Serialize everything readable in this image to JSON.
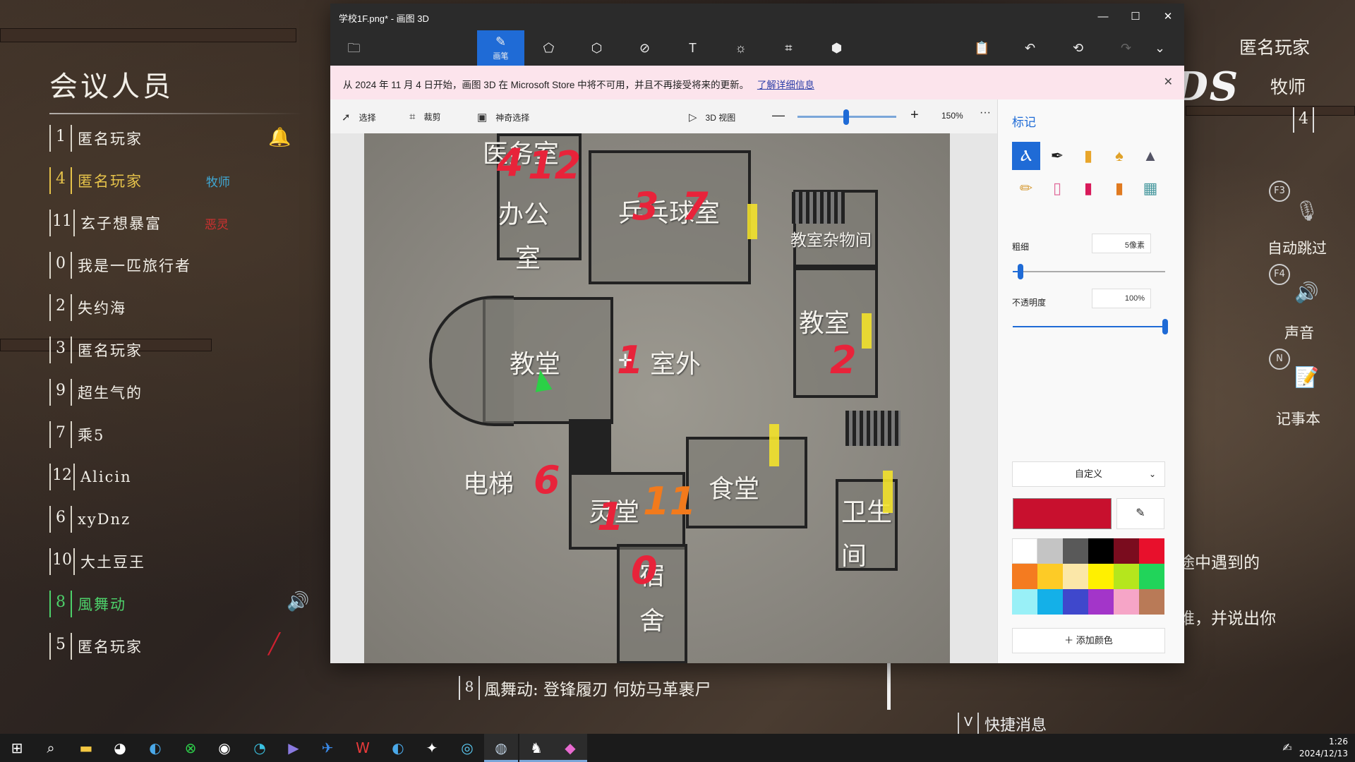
{
  "meeting": {
    "title": "会议人员",
    "members": [
      {
        "num": "1",
        "name": "匿名玩家",
        "role": "",
        "role_color": ""
      },
      {
        "num": "4",
        "name": "匿名玩家",
        "role": "牧师",
        "role_color": "#3fa9d6"
      },
      {
        "num": "11",
        "name": "玄子想暴富",
        "role": "恶灵",
        "role_color": "#d23030"
      },
      {
        "num": "0",
        "name": "我是一匹旅行者",
        "role": "",
        "role_color": ""
      },
      {
        "num": "2",
        "name": "失约海",
        "role": "",
        "role_color": ""
      },
      {
        "num": "3",
        "name": "匿名玩家",
        "role": "",
        "role_color": ""
      },
      {
        "num": "9",
        "name": "超生气的",
        "role": "",
        "role_color": ""
      },
      {
        "num": "7",
        "name": "乘5",
        "role": "",
        "role_color": ""
      },
      {
        "num": "12",
        "name": "Alicin",
        "role": "",
        "role_color": ""
      },
      {
        "num": "6",
        "name": "xyDnz",
        "role": "",
        "role_color": ""
      },
      {
        "num": "10",
        "name": "大土豆王",
        "role": "",
        "role_color": ""
      },
      {
        "num": "8",
        "name": "風舞动",
        "role": "",
        "role_color": ""
      },
      {
        "num": "5",
        "name": "匿名玩家",
        "role": "",
        "role_color": ""
      }
    ]
  },
  "hud": {
    "player_name": "匿名玩家",
    "player_role": "牧师",
    "player_num": "4",
    "key_f3": "F3",
    "auto_skip": "自动跳过",
    "key_f4": "F4",
    "sound": "声音",
    "key_n": "N",
    "notebook": "记事本",
    "game_logo": "NDS"
  },
  "subtitles": {
    "line1": "途中遇到的",
    "line2": "谁，并说出你"
  },
  "chat": {
    "num": "8",
    "text": "風舞动: 登锋履刃 何妨马革裹尸"
  },
  "quick_msg": {
    "key": "V",
    "text": "快捷消息"
  },
  "paint": {
    "window_title": "学校1F.png* - 画图 3D",
    "active_tool_label": "画笔",
    "notice": "从 2024 年 11 月 4 日开始，画图 3D 在 Microsoft Store 中将不可用，并且不再接受将来的更新。",
    "notice_link": "了解详细信息",
    "canvas_tools": {
      "select": "选择",
      "crop": "裁剪",
      "magic_select": "神奇选择",
      "view3d": "3D 视图",
      "zoom": "150%",
      "zoom_level": 0.5
    },
    "panel": {
      "title": "标记",
      "thickness_label": "粗细",
      "thickness_value": "5像素",
      "thickness_level": 0.05,
      "opacity_label": "不透明度",
      "opacity_value": "100%",
      "opacity_level": 1.0,
      "color_mode": "自定义",
      "add_color": "添加颜色",
      "selected_color": "#c8102e",
      "swatches": [
        "#ffffff",
        "#c4c4c4",
        "#595959",
        "#000000",
        "#7a0c1e",
        "#e8102c",
        "#f47b20",
        "#fdcb26",
        "#fbe7a8",
        "#fff000",
        "#b5e61d",
        "#21d45a",
        "#99f0f7",
        "#14b0e8",
        "#3f48cc",
        "#a335c9",
        "#f6a5c7",
        "#b97a57"
      ]
    },
    "map": {
      "rooms": {
        "infirmary": "医务室",
        "office1": "办公",
        "office2": "室",
        "pingpong": "乒乓球室",
        "storage": "教室杂物间",
        "chapel": "教堂",
        "outdoor": "室外",
        "classroom": "教室",
        "elevator": "电梯",
        "spirit": "灵堂",
        "canteen": "食堂",
        "bath1": "卫生",
        "bath2": "间",
        "dorm1": "宿",
        "dorm2": "舍"
      },
      "marks": [
        "4",
        "12",
        "3",
        "7",
        "2",
        "6",
        "1",
        "11",
        "0",
        "1"
      ]
    }
  },
  "taskbar": {
    "time": "1:26",
    "date": "2024/12/13"
  }
}
